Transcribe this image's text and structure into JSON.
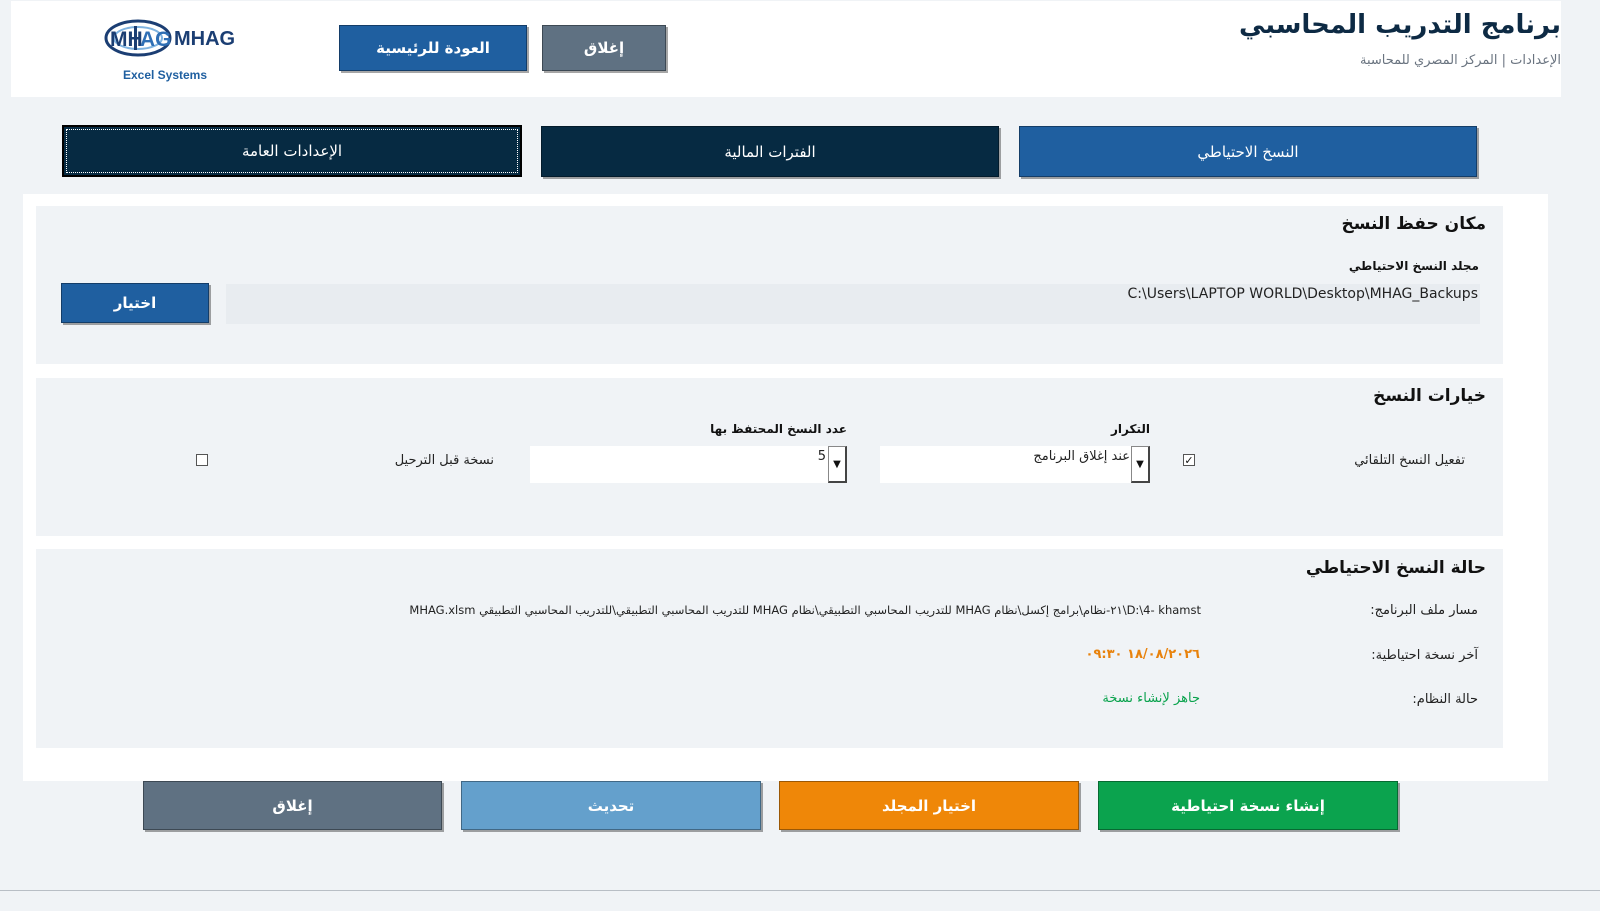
{
  "header": {
    "title": "برنامج التدريب المحاسبي",
    "subtitle": "الإعدادات | المركز المصري للمحاسبة",
    "back_button": "العودة للرئيسية",
    "close_button": "إغلاق",
    "logo_text": "MHAG",
    "logo_tagline": "Excel Systems"
  },
  "tabs": [
    {
      "label": "النسخ الاحتياطي",
      "state": "selected"
    },
    {
      "label": "الفترات المالية",
      "state": "normal"
    },
    {
      "label": "الإعدادات العامة",
      "state": "focused"
    }
  ],
  "location_panel": {
    "title": "مكان حفظ النسخ",
    "folder_label": "مجلد النسخ الاحتياطي",
    "folder_value": "C:\\Users\\LAPTOP WORLD\\Desktop\\MHAG_Backups",
    "browse_button": "اختيار"
  },
  "options_panel": {
    "title": "خيارات النسخ",
    "auto_backup_label": "تفعيل النسخ التلقائي",
    "auto_backup_checked": true,
    "frequency_label": "التكرار",
    "frequency_value": "عند إغلاق البرنامج",
    "count_label": "عدد النسخ المحتفظ بها",
    "count_value": "5",
    "before_posting_label": "نسخة قبل الترحيل",
    "before_posting_checked": false
  },
  "status_panel": {
    "title": "حالة النسخ الاحتياطي",
    "path_label": "مسار ملف البرنامج:",
    "path_value": "D:\\4- khamst\\٢١-نظام\\برامج إكسل\\نظام MHAG للتدريب المحاسبي التطبيقي\\نظام MHAG للتدريب المحاسبي التطبيقي\\للتدريب المحاسبي التطبيقي MHAG.xlsm",
    "last_backup_label": "آخر نسخة احتياطية:",
    "last_backup_value": "١٨/٠٨/٢٠٢٦ ٠٩:٣٠",
    "last_backup_color": "#e8820c",
    "system_status_label": "حالة النظام:",
    "system_status_value": "جاهز لإنشاء نسخة",
    "system_status_color": "#0ba34e"
  },
  "footer": {
    "create_backup": "إنشاء نسخة احتياطية",
    "choose_folder": "اختيار المجلد",
    "refresh": "تحديث",
    "close": "إغلاق"
  },
  "colors": {
    "primary_blue": "#1f5fa0",
    "navy": "#062a42",
    "gray_button": "#5f7182",
    "green": "#0ba34e",
    "orange": "#ef8708",
    "light_blue": "#64a0cc"
  }
}
